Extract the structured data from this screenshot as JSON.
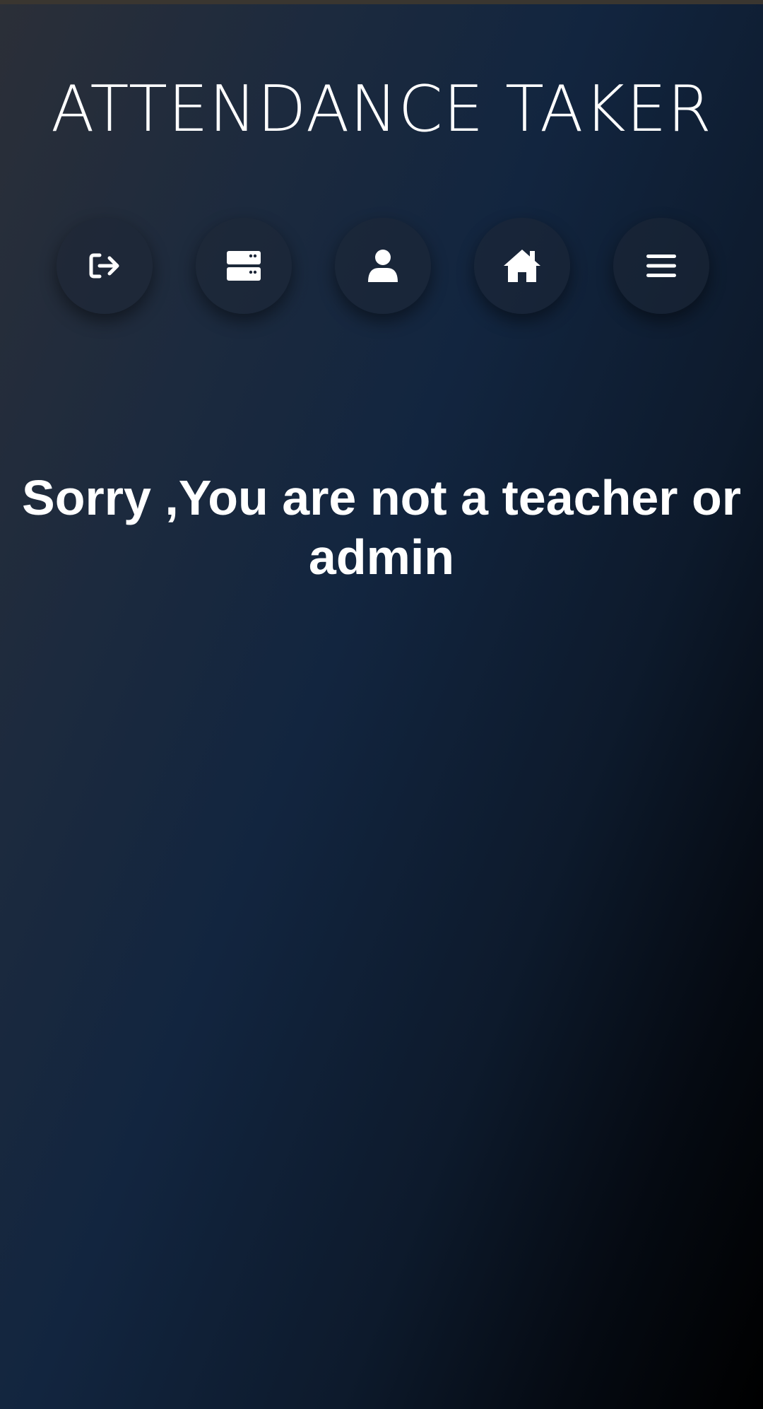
{
  "app": {
    "title": "ATTENDANCE TAKER"
  },
  "nav": {
    "buttons": [
      {
        "icon": "logout-icon"
      },
      {
        "icon": "server-icon"
      },
      {
        "icon": "user-icon"
      },
      {
        "icon": "home-icon"
      },
      {
        "icon": "menu-icon"
      }
    ]
  },
  "main": {
    "message": "Sorry ,You are not a teacher or admin"
  },
  "colors": {
    "text": "#ffffff",
    "background_start": "#2b2f38",
    "background_mid": "#12253f",
    "background_end": "#000000"
  }
}
